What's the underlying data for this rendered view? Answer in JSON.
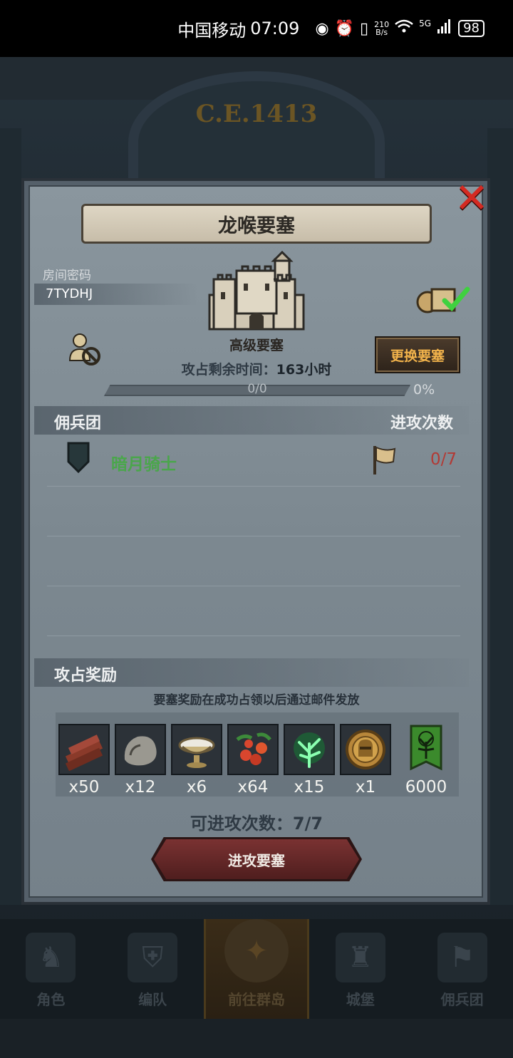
{
  "status_bar": {
    "carrier": "中国移动",
    "time": "07:09",
    "net_speed_value": "210",
    "net_speed_unit": "B/s",
    "network": "5G",
    "battery": "98"
  },
  "background": {
    "era": "C.E.1413"
  },
  "modal": {
    "title": "龙喉要塞",
    "password_label": "房间密码",
    "password_value": "7TYDHJ",
    "fortress_type": "高级要塞",
    "change_button": "更换要塞",
    "time_label": "攻占剩余时间：",
    "time_value": "163小时",
    "progress_text": "0/0",
    "progress_percent": "0%",
    "progress_fraction": 0,
    "mercenary_section_title": "佣兵团",
    "attack_count_title": "进攻次数",
    "mercenaries": [
      {
        "name": "暗月骑士",
        "attacks": "0/7"
      }
    ],
    "reward_section_title": "攻占奖励",
    "reward_note": "要塞奖励在成功占领以后通过邮件发放",
    "rewards": [
      {
        "icon": "wood-icon",
        "qty": "x50"
      },
      {
        "icon": "ore-icon",
        "qty": "x12"
      },
      {
        "icon": "bowl-icon",
        "qty": "x6"
      },
      {
        "icon": "berries-icon",
        "qty": "x64"
      },
      {
        "icon": "green-tree-icon",
        "qty": "x15"
      },
      {
        "icon": "knight-medal-icon",
        "qty": "x1"
      },
      {
        "icon": "banner-icon",
        "qty": "6000"
      }
    ],
    "attempts_label": "可进攻次数：7/7",
    "attack_button": "进攻要塞"
  },
  "bottom_nav": [
    {
      "label": "角色",
      "active": false
    },
    {
      "label": "编队",
      "active": false
    },
    {
      "label": "前往群岛",
      "active": true
    },
    {
      "label": "城堡",
      "active": false
    },
    {
      "label": "佣兵团",
      "active": false
    }
  ],
  "colors": {
    "title_banner": "#d6cdb9",
    "change_button_text": "#f2b34b",
    "mercenary_name": "#4aa64b",
    "attack_count": "#b23a35",
    "close_x": "#d42a22",
    "attack_button": "#6a2a2a"
  }
}
